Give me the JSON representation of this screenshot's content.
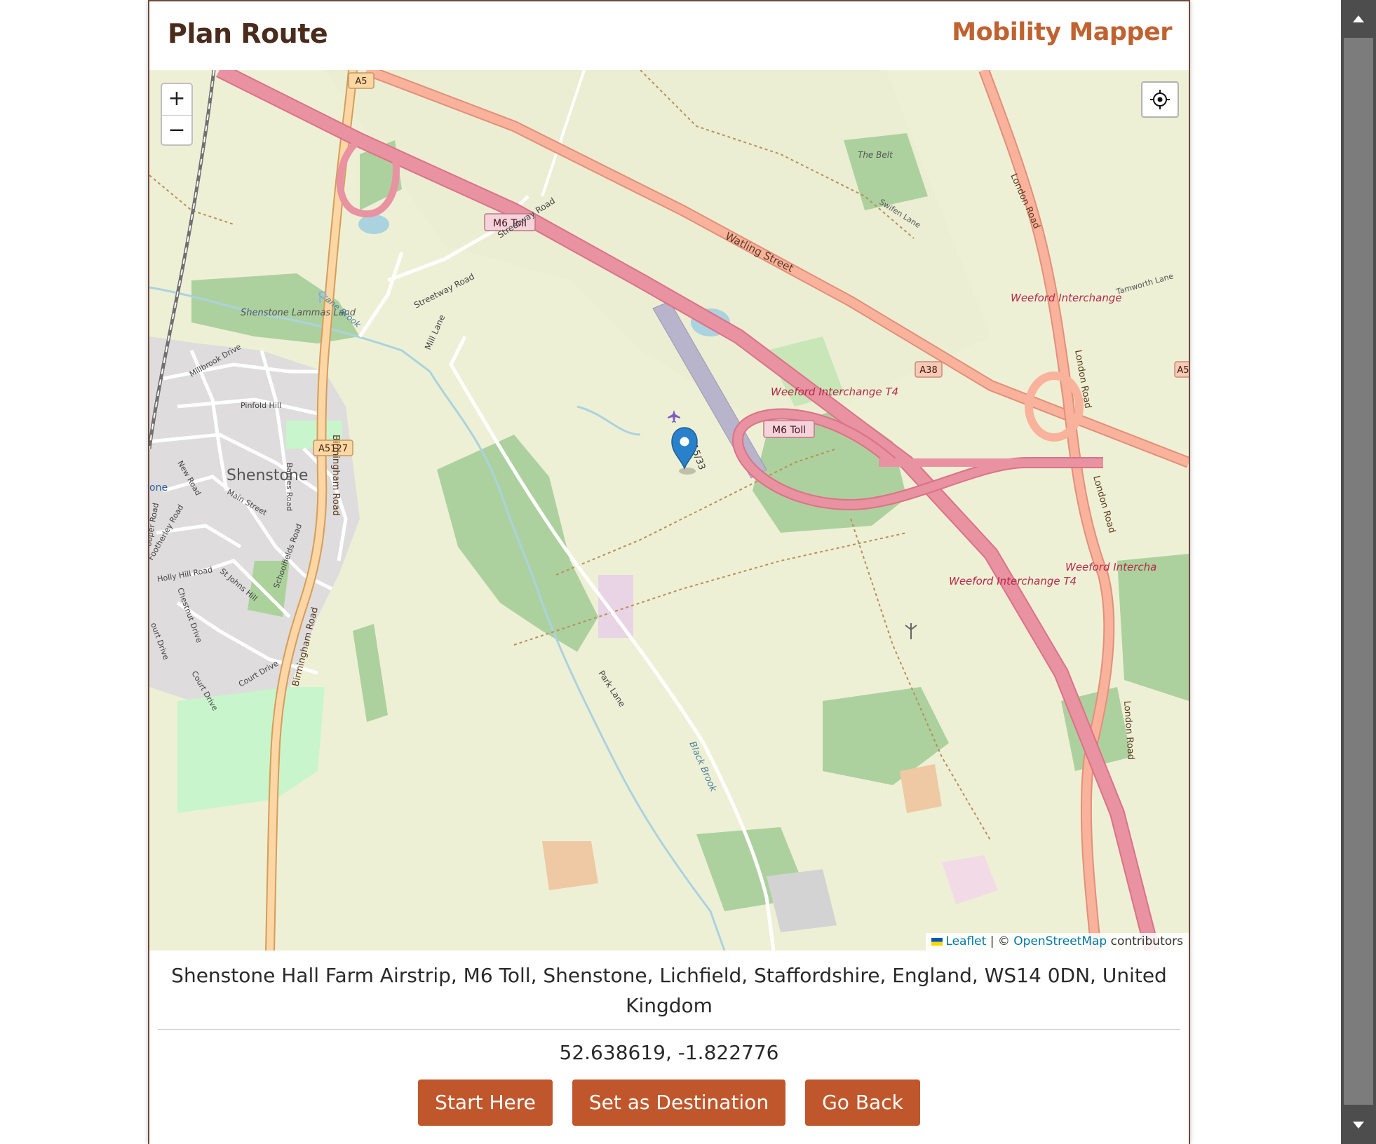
{
  "header": {
    "title": "Plan Route",
    "brand": "Mobility Mapper"
  },
  "map": {
    "zoom_in_label": "+",
    "zoom_out_label": "−",
    "attribution": {
      "leaflet": "Leaflet",
      "separator": "| ©",
      "osm": "OpenStreetMap",
      "contributors": "contributors"
    },
    "labels": {
      "watling_street": "Watling Street",
      "m6_toll_1": "M6 Toll",
      "m6_toll_2": "M6 Toll",
      "a5": "A5",
      "a38": "A38",
      "a5127": "A5127",
      "a5_right": "A5",
      "shenstone": "Shenstone",
      "lammas": "Shenstone Lammas Land",
      "weeford_t4_1": "Weeford Interchange T4",
      "weeford_t4_2": "Weeford Interchange T4",
      "weeford_interchange": "Weeford Interchange",
      "weeford_interchange_cut": "Weeford Intercha",
      "london_road_1": "London Road",
      "london_road_2": "London Road",
      "london_road_3": "London Road",
      "london_road_4": "London Road",
      "birmingham_road_1": "Birmingham Road",
      "birmingham_road_2": "Birmingham Road",
      "streetway_road_1": "Streetway Road",
      "streetway_road_2": "Streetway Road",
      "mill_lane": "Mill Lane",
      "park_lane": "Park Lane",
      "black_brook": "Black Brook",
      "crane_brook": "Crane Brook",
      "the_belt": "The Belt",
      "swifen_lane": "Swifen Lane",
      "tamworth_lane": "Tamworth Lane",
      "runway": "15/33",
      "millbrook_drive": "Millbrook Drive",
      "pinfold_hill": "Pinfold Hill",
      "new_road": "New Road",
      "main_street": "Main Street",
      "barnes_road": "Barnes Road",
      "footherley_road": "Footherley Road",
      "holly_hill_road": "Holly Hill Road",
      "st_johns_hill": "St Johns Hill",
      "schoolfields_road": "Schoolfields Road",
      "chestnut_drive": "Chestnut Drive",
      "court_drive_1": "Court Drive",
      "court_drive_2": "Court Drive",
      "one": "one",
      "cooper_road": "ooper Road",
      "ourt_drive": "ourt Drive"
    },
    "colors": {
      "motorway": "#e892a2",
      "trunk": "#f9b29c",
      "primary": "#fcd6a4",
      "land": "#f1efe3",
      "farmland": "#eef0d5",
      "wood": "#add19e",
      "water": "#aad3df",
      "residential": "#e0dfdf",
      "marker": "#2a81cb"
    }
  },
  "location": {
    "address": "Shenstone Hall Farm Airstrip, M6 Toll, Shenstone, Lichfield, Staffordshire, England, WS14 0DN, United Kingdom",
    "coords": "52.638619, -1.822776"
  },
  "actions": {
    "start_here": "Start Here",
    "set_destination": "Set as Destination",
    "go_back": "Go Back"
  },
  "icons": {
    "locate": "crosshair-icon",
    "marker": "map-marker-icon",
    "airport": "airplane-icon",
    "wind": "wind-turbine-icon",
    "scroll_up": "scroll-up-arrow-icon",
    "scroll_down": "scroll-down-arrow-icon"
  }
}
